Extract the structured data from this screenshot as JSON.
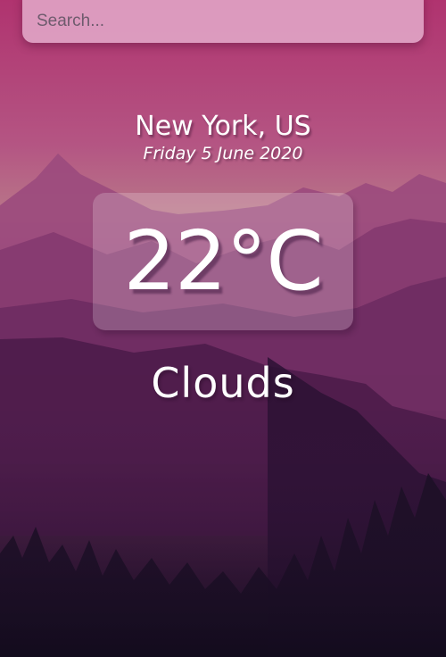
{
  "search": {
    "placeholder": "Search...",
    "value": ""
  },
  "weather": {
    "location": "New York, US",
    "date": "Friday 5 June 2020",
    "temperature": "22°C",
    "condition": "Clouds"
  },
  "colors": {
    "sky_top": "#b33a78",
    "sky_mid": "#b45c84",
    "mountain_far": "#9a4a7e",
    "mountain_mid": "#6e2e62",
    "valley_dark": "#2a1232",
    "forest_bottom": "#120c1e",
    "search_bg": "#e8b6d3",
    "text": "#ffffff"
  }
}
